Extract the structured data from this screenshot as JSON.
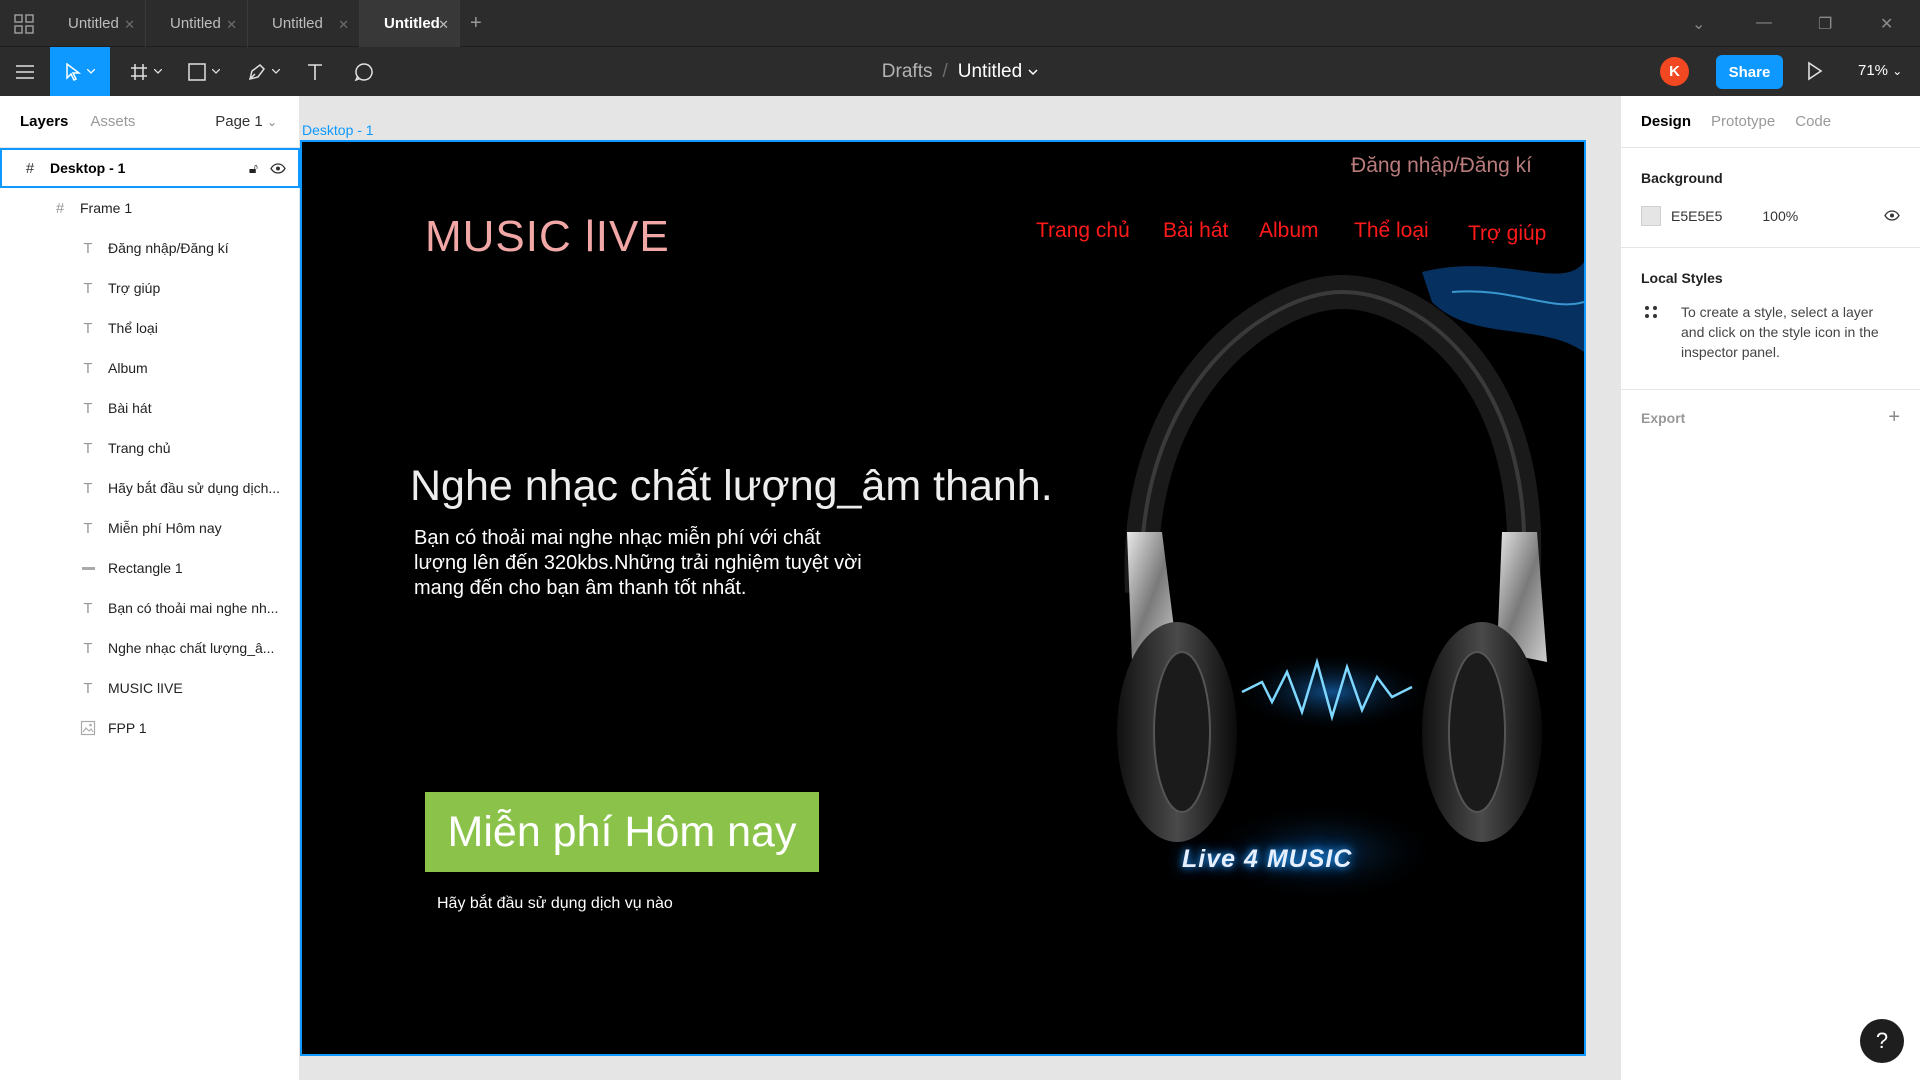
{
  "tabs": [
    {
      "label": "Untitled"
    },
    {
      "label": "Untitled"
    },
    {
      "label": "Untitled"
    },
    {
      "label": "Untitled"
    }
  ],
  "toolbar": {
    "breadcrumb_parent": "Drafts",
    "file_name": "Untitled",
    "avatar_initial": "K",
    "share_label": "Share",
    "zoom": "71%"
  },
  "left_panel": {
    "tab_layers": "Layers",
    "tab_assets": "Assets",
    "page": "Page 1",
    "layers": [
      {
        "name": "Desktop - 1",
        "type": "frame"
      },
      {
        "name": "Frame 1",
        "type": "frame"
      },
      {
        "name": "Đăng nhập/Đăng kí",
        "type": "text"
      },
      {
        "name": "Trợ giúp",
        "type": "text"
      },
      {
        "name": "Thể loại",
        "type": "text"
      },
      {
        "name": "Album",
        "type": "text"
      },
      {
        "name": "Bài hát",
        "type": "text"
      },
      {
        "name": "Trang chủ",
        "type": "text"
      },
      {
        "name": "Hãy bắt đầu sử dụng dịch...",
        "type": "text"
      },
      {
        "name": "Miễn phí Hôm nay",
        "type": "text"
      },
      {
        "name": "Rectangle 1",
        "type": "rectangle"
      },
      {
        "name": "Bạn có thoải mai nghe nh...",
        "type": "text"
      },
      {
        "name": "Nghe nhạc chất lượng_â...",
        "type": "text"
      },
      {
        "name": "MUSIC lIVE",
        "type": "text"
      },
      {
        "name": "FPP 1",
        "type": "image"
      }
    ]
  },
  "canvas": {
    "frame_label": "Desktop - 1",
    "login": "Đăng nhập/Đăng kí",
    "logo": "MUSIC lIVE",
    "nav": [
      "Trang chủ",
      "Bài hát",
      "Album",
      "Thể loại",
      "Trợ giúp"
    ],
    "headline": "Nghe nhạc chất lượng_âm thanh.",
    "description": "Bạn có thoải mai nghe nhạc miễn phí với chất lượng lên đến 320kbs.Những trải nghiệm tuyệt vời mang đến cho bạn âm thanh tốt nhất.",
    "cta": "Miễn phí Hôm nay",
    "cta_sub": "Hãy bắt đầu sử dụng dịch vụ nào",
    "image_text": "Live 4 MUSIC"
  },
  "right_panel": {
    "tabs": [
      "Design",
      "Prototype",
      "Code"
    ],
    "background_title": "Background",
    "background_hex": "E5E5E5",
    "background_opacity": "100%",
    "local_styles_title": "Local Styles",
    "local_styles_hint": "To create a style, select a layer and click on the style icon in the inspector panel.",
    "export_title": "Export"
  },
  "colors": {
    "accent": "#0d99ff",
    "cta_green": "#8bc34a",
    "nav_red": "#ff1a1a",
    "avatar": "#f24822"
  },
  "help_label": "?"
}
